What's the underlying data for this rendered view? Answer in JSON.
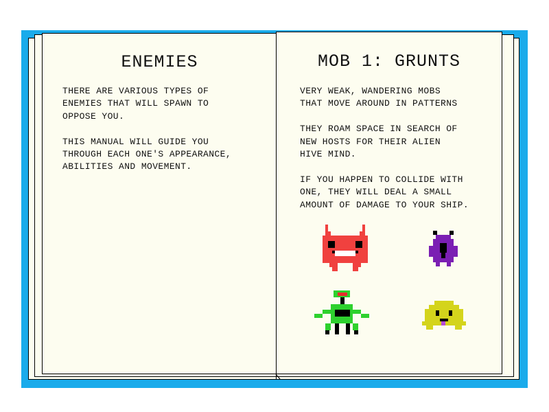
{
  "manual": {
    "left_page": {
      "title": "ENEMIES",
      "paragraphs": [
        "THERE ARE VARIOUS TYPES OF\nENEMIES THAT WILL SPAWN TO\nOPPOSE YOU.",
        "THIS MANUAL WILL GUIDE YOU\nTHROUGH EACH ONE'S APPEARANCE,\nABILITIES AND MOVEMENT."
      ]
    },
    "right_page": {
      "title": "MOB 1: GRUNTS",
      "paragraphs": [
        "VERY WEAK, WANDERING MOBS\nTHAT MOVE AROUND IN PATTERNS",
        "THEY ROAM SPACE IN SEARCH OF\nNEW HOSTS FOR THEIR ALIEN\nHIVE MIND.",
        "IF YOU HAPPEN TO COLLIDE WITH\nONE, THEY WILL DEAL A SMALL\nAMOUNT OF DAMAGE TO YOUR SHIP."
      ]
    },
    "sprites": [
      {
        "name": "red-grunt-sprite",
        "color": "#f0413f"
      },
      {
        "name": "purple-grunt-sprite",
        "color": "#7b1fb3"
      },
      {
        "name": "green-grunt-sprite",
        "color": "#2ed12e"
      },
      {
        "name": "yellow-grunt-sprite",
        "color": "#d4d41c"
      }
    ]
  }
}
